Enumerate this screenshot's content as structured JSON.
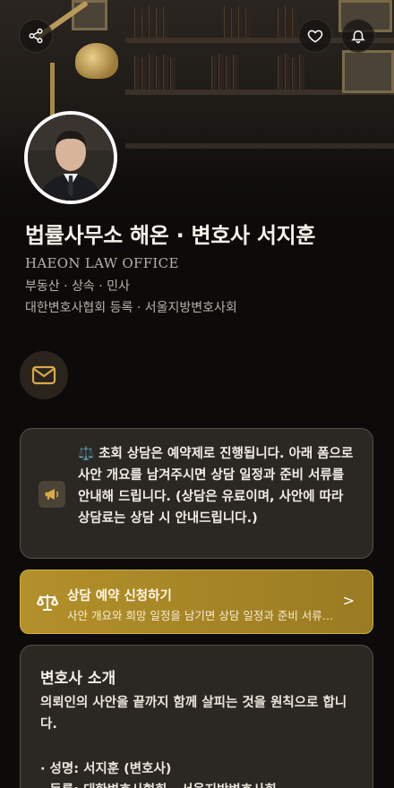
{
  "header": {
    "share_icon": "share-icon",
    "favorite_icon": "heart-icon",
    "notify_icon": "bell-icon"
  },
  "profile": {
    "name": "법률사무소 해온 · 변호사 서지훈",
    "office_en": "HAEON LAW OFFICE",
    "practice_areas": "부동산 · 상속 · 민사",
    "registration": "대한변호사협회 등록 · 서울지방변호사회"
  },
  "contact": {
    "mail_icon": "mail-icon"
  },
  "notice": {
    "icon": "megaphone-icon",
    "text": "⚖️ 초회 상담은 예약제로 진행됩니다. 아래 폼으로 사안 개요를 남겨주시면 상담 일정과 준비 서류를 안내해 드립니다. (상담은 유료이며, 사안에 따라 상담료는 상담 시 안내드립니다.)"
  },
  "cta": {
    "icon": "scales-icon",
    "title": "상담 예약 신청하기",
    "subtitle": "사안 개요와 희망 일정을 남기면 상담 일정과 준비 서류를 안내해 드립니다.",
    "arrow": ">"
  },
  "intro": {
    "title": "변호사 소개",
    "body": "의뢰인의 사안을 끝까지 함께 살피는 것을 원칙으로 합니다.",
    "items": [
      "· 성명: 서지훈 (변호사)",
      "· 등록: 대한변호사협회 · 서울지방변호사회"
    ]
  },
  "colors": {
    "accent_gold": "#b2902a",
    "card_bg": "#2b2824",
    "page_bg": "#0c0b0a"
  }
}
